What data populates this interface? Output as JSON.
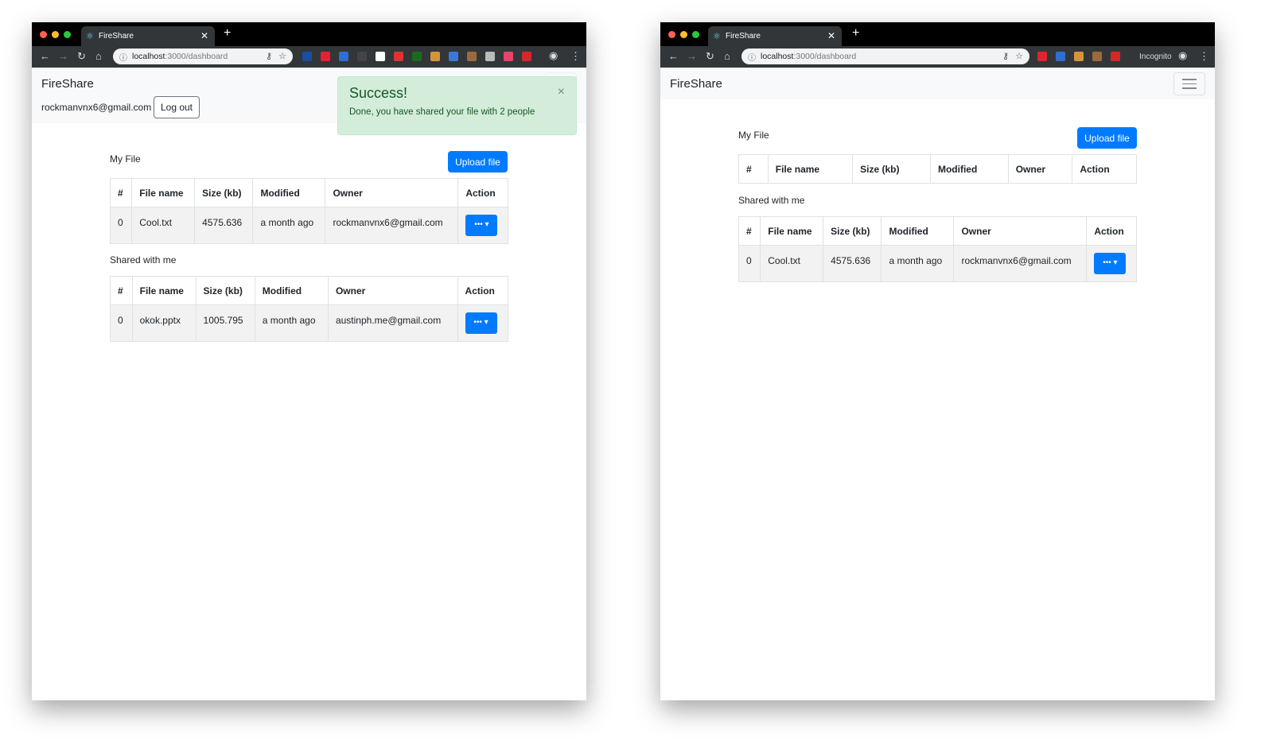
{
  "windows": [
    {
      "tab_title": "FireShare",
      "url_host": "localhost",
      "url_path": ":3000/dashboard",
      "extensions": [
        "#1a4fa0",
        "#e0242f",
        "#2f6fd0",
        "#444",
        "#fff",
        "#d33",
        "#1c6a1c",
        "#d4953a",
        "#3a78d8",
        "#9b6a3a",
        "#bbb",
        "#e8436a",
        "#d62828"
      ],
      "navbar": {
        "brand": "FireShare",
        "user_email": "rockmanvnx6@gmail.com",
        "logout_label": "Log out"
      },
      "alert": {
        "title": "Success!",
        "message": "Done, you have shared your file with 2 people",
        "close": "×"
      },
      "my_file": {
        "label": "My File",
        "upload_label": "Upload file",
        "columns": [
          "#",
          "File name",
          "Size (kb)",
          "Modified",
          "Owner",
          "Action"
        ],
        "rows": [
          [
            "0",
            "Cool.txt",
            "4575.636",
            "a month ago",
            "rockmanvnx6@gmail.com"
          ]
        ]
      },
      "shared": {
        "label": "Shared with me",
        "columns": [
          "#",
          "File name",
          "Size (kb)",
          "Modified",
          "Owner",
          "Action"
        ],
        "rows": [
          [
            "0",
            "okok.pptx",
            "1005.795",
            "a month ago",
            "austinph.me@gmail.com"
          ]
        ]
      }
    },
    {
      "tab_title": "FireShare",
      "url_host": "localhost",
      "url_path": ":3000/dashboard",
      "incognito_label": "Incognito",
      "extensions": [
        "#e0242f",
        "#2f6fd0",
        "#d4953a",
        "#9b6a3a",
        "#d62828"
      ],
      "navbar": {
        "brand": "FireShare"
      },
      "my_file": {
        "label": "My File",
        "upload_label": "Upload file",
        "columns": [
          "#",
          "File name",
          "Size (kb)",
          "Modified",
          "Owner",
          "Action"
        ],
        "rows": []
      },
      "shared": {
        "label": "Shared with me",
        "columns": [
          "#",
          "File name",
          "Size (kb)",
          "Modified",
          "Owner",
          "Action"
        ],
        "rows": [
          [
            "0",
            "Cool.txt",
            "4575.636",
            "a month ago",
            "rockmanvnx6@gmail.com"
          ]
        ]
      }
    }
  ],
  "action_button_label": "••• ▾"
}
